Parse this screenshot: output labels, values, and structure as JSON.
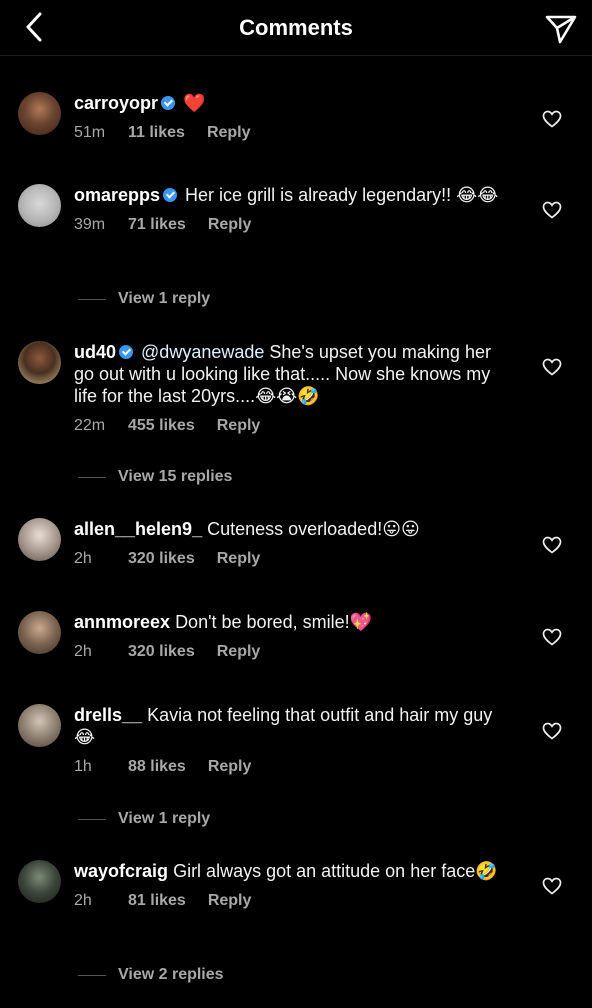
{
  "header": {
    "title": "Comments"
  },
  "comments": [
    {
      "user": "carroyopr",
      "verified": true,
      "text": "❤️",
      "time": "51m",
      "likes": "11 likes",
      "reply": "Reply"
    },
    {
      "user": "omarepps",
      "verified": true,
      "text": "Her ice grill is already legendary!! 😂😂",
      "time": "39m",
      "likes": "71 likes",
      "reply": "Reply",
      "view_replies": "View 1 reply"
    },
    {
      "user": "ud40",
      "verified": true,
      "mention": "@dwyanewade",
      "text": " She's upset you making her go out with u looking like that..... Now she knows my life for the last 20yrs....😂😭🤣",
      "time": "22m",
      "likes": "455 likes",
      "reply": "Reply",
      "view_replies": "View 15 replies"
    },
    {
      "user": "allen__helen9_",
      "verified": false,
      "text": "Cuteness overloaded!😛😛",
      "time": "2h",
      "likes": "320 likes",
      "reply": "Reply"
    },
    {
      "user": "annmoreex",
      "verified": false,
      "text": "Don't be bored, smile!💖",
      "time": "2h",
      "likes": "320 likes",
      "reply": "Reply"
    },
    {
      "user": "drells__",
      "verified": false,
      "text": "Kavia not feeling that outfit and hair my guy 😂",
      "time": "1h",
      "likes": "88 likes",
      "reply": "Reply",
      "view_replies": "View 1 reply"
    },
    {
      "user": "wayofcraig",
      "verified": false,
      "text": "Girl always got an attitude on her face🤣",
      "time": "2h",
      "likes": "81 likes",
      "reply": "Reply",
      "view_replies": "View 2 replies"
    }
  ]
}
